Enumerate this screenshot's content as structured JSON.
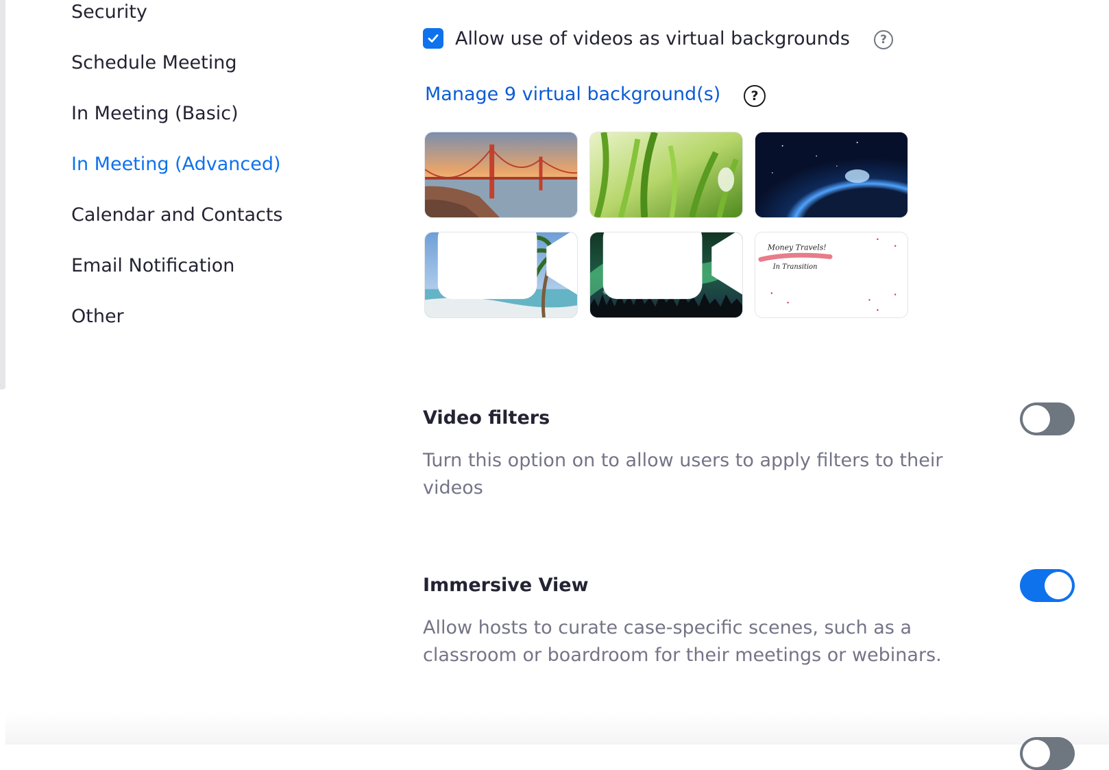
{
  "sidebar": {
    "items": [
      {
        "label": "Security",
        "active": false
      },
      {
        "label": "Schedule Meeting",
        "active": false
      },
      {
        "label": "In Meeting (Basic)",
        "active": false
      },
      {
        "label": "In Meeting (Advanced)",
        "active": true
      },
      {
        "label": "Calendar and Contacts",
        "active": false
      },
      {
        "label": "Email Notification",
        "active": false
      },
      {
        "label": "Other",
        "active": false
      }
    ]
  },
  "virtual_backgrounds": {
    "allow_videos_label": "Allow use of videos as virtual backgrounds",
    "allow_videos_checked": true,
    "manage_link": "Manage 9 virtual background(s)",
    "thumbnails": [
      {
        "name": "golden-gate-bridge",
        "is_video": false
      },
      {
        "name": "green-grass",
        "is_video": false
      },
      {
        "name": "earth-from-space",
        "is_video": false
      },
      {
        "name": "tropical-beach",
        "is_video": true
      },
      {
        "name": "aurora-borealis",
        "is_video": true
      },
      {
        "name": "money-travels-logo",
        "is_video": false
      }
    ],
    "thumbnail_text": {
      "line1": "Money Travels!",
      "line2": "In Transition"
    }
  },
  "settings": [
    {
      "title": "Video filters",
      "description": "Turn this option on to allow users to apply filters to their videos",
      "enabled": false
    },
    {
      "title": "Immersive View",
      "description": "Allow hosts to curate case-specific scenes, such as a classroom or boardroom for their meetings or webinars.",
      "enabled": true
    }
  ],
  "colors": {
    "accent": "#0e72ed",
    "link": "#0b5cd5",
    "toggle_off": "#6e7680",
    "text": "#232333",
    "muted_text": "#747487"
  },
  "icons": {
    "checkbox": "checkmark-icon",
    "help": "question-circle-icon",
    "video_badge": "video-camera-icon"
  }
}
